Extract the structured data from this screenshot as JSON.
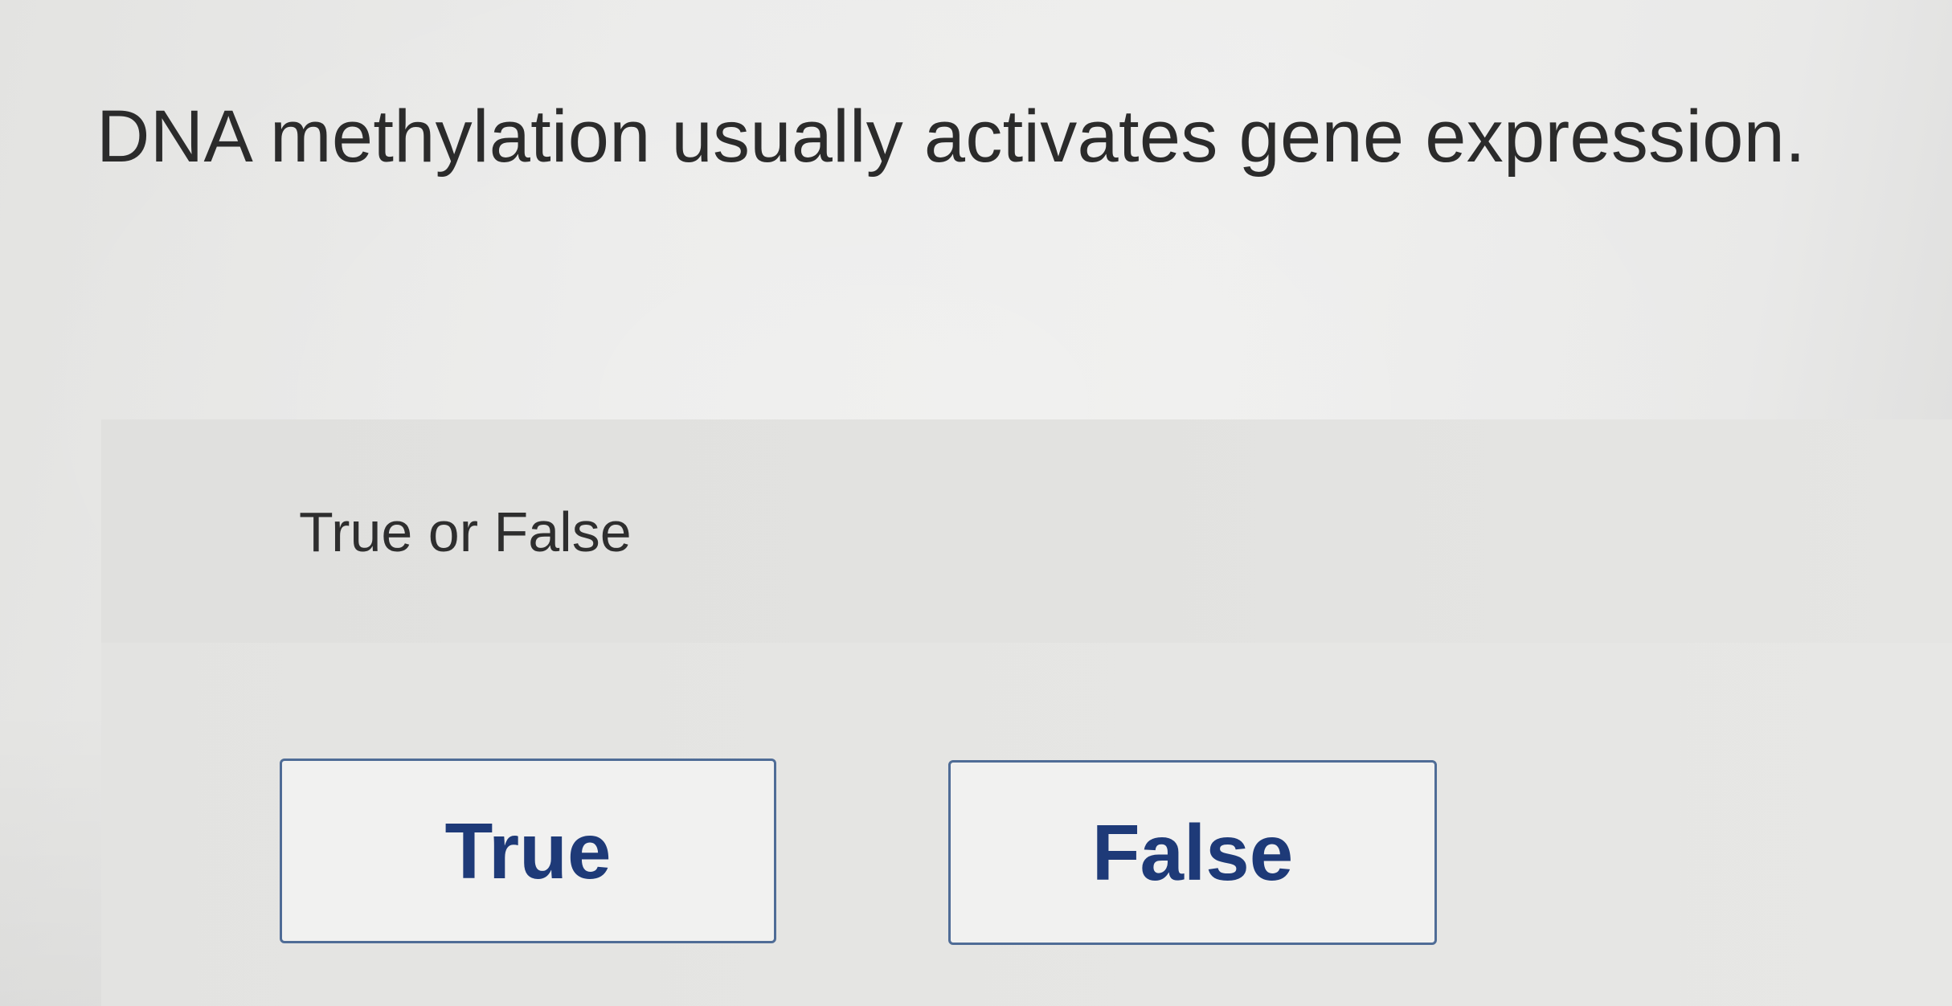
{
  "question": {
    "text": "DNA methylation usually activates gene expression."
  },
  "answer_panel": {
    "prompt": "True or False",
    "options": [
      {
        "label": "True"
      },
      {
        "label": "False"
      }
    ]
  },
  "colors": {
    "button_border": "#4f6c96",
    "button_text": "#1e3a78",
    "question_text": "#2b2b2b"
  }
}
